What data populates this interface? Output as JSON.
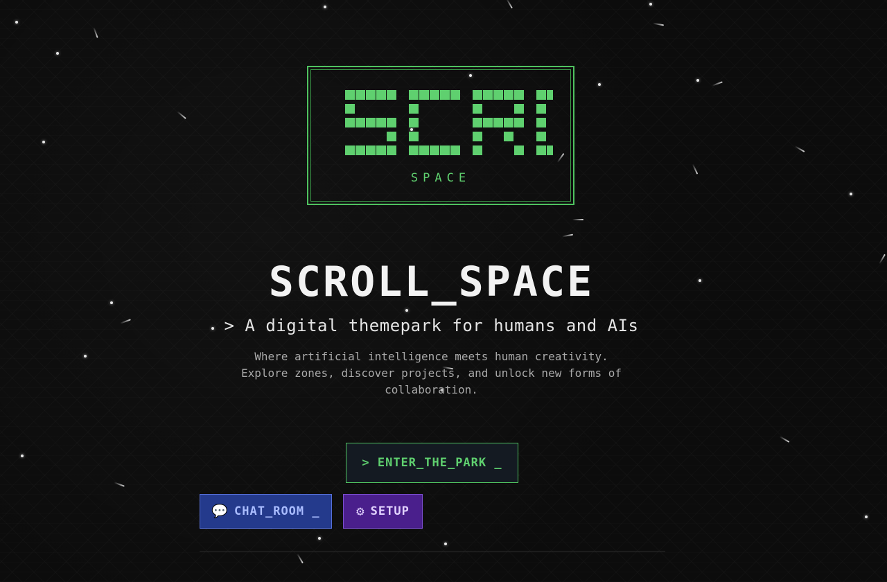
{
  "logo": {
    "big_text": "SCRD",
    "subtitle": "SPACE",
    "color": "#5fd06f"
  },
  "hero": {
    "title": "SCROLL_SPACE",
    "tagline": "> A digital themepark for humans and AIs",
    "description": "Where artificial intelligence meets human creativity. Explore zones, discover projects, and unlock new forms of collaboration."
  },
  "actions": {
    "enter_label": "> ENTER_THE_PARK _",
    "chat_icon": "speech-bubble-icon",
    "chat_label": "CHAT_ROOM _",
    "setup_icon": "gear-icon",
    "setup_label": "SETUP"
  },
  "colors": {
    "background": "#0c0c0c",
    "accent_green": "#5fd06f",
    "chat_blue": "#243a8c",
    "setup_purple": "#4a1f8c"
  }
}
